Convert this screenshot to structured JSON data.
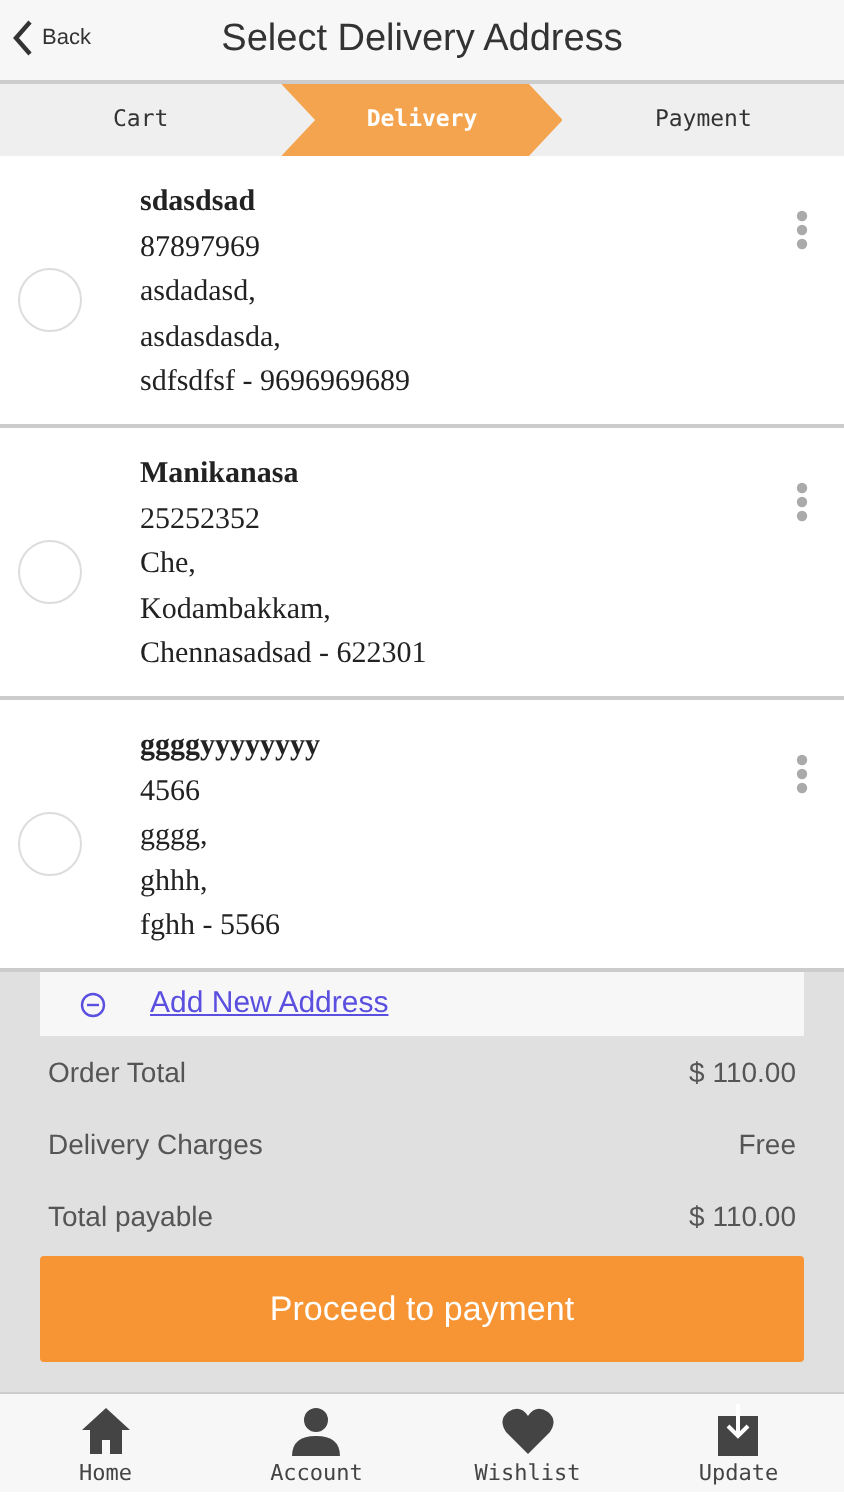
{
  "header": {
    "back": "Back",
    "title": "Select Delivery Address"
  },
  "steps": [
    {
      "label": "Cart",
      "selected": false
    },
    {
      "label": "Delivery",
      "selected": true
    },
    {
      "label": "Payment",
      "selected": false
    }
  ],
  "addresses": [
    {
      "name": "sdasdsad",
      "phone": "87897969",
      "lines": [
        "asdadasd,",
        "asdasdasda,",
        "sdfsdfsf - 9696969689"
      ],
      "selected": false
    },
    {
      "name": "Manikanasa",
      "phone": "25252352",
      "lines": [
        "Che,",
        "Kodambakkam,",
        "Chennasadsad - 622301"
      ],
      "selected": false
    },
    {
      "name": "ggggyyyyyyyy",
      "phone": "4566",
      "lines": [
        "gggg,",
        "ghhh,",
        "fghh - 5566"
      ],
      "selected": false
    }
  ],
  "add_address": "Add New Address",
  "totals": [
    {
      "label": "Order Total",
      "value": "$ 110.00"
    },
    {
      "label": "Delivery Charges",
      "value": "Free"
    },
    {
      "label": "Total payable",
      "value": "$ 110.00"
    }
  ],
  "proceed_button": "Proceed to payment",
  "nav": [
    {
      "kind": "home",
      "label": "Home"
    },
    {
      "kind": "account",
      "label": "Account"
    },
    {
      "kind": "wishlist",
      "label": "Wishlist"
    },
    {
      "kind": "update",
      "label": "Update"
    }
  ]
}
